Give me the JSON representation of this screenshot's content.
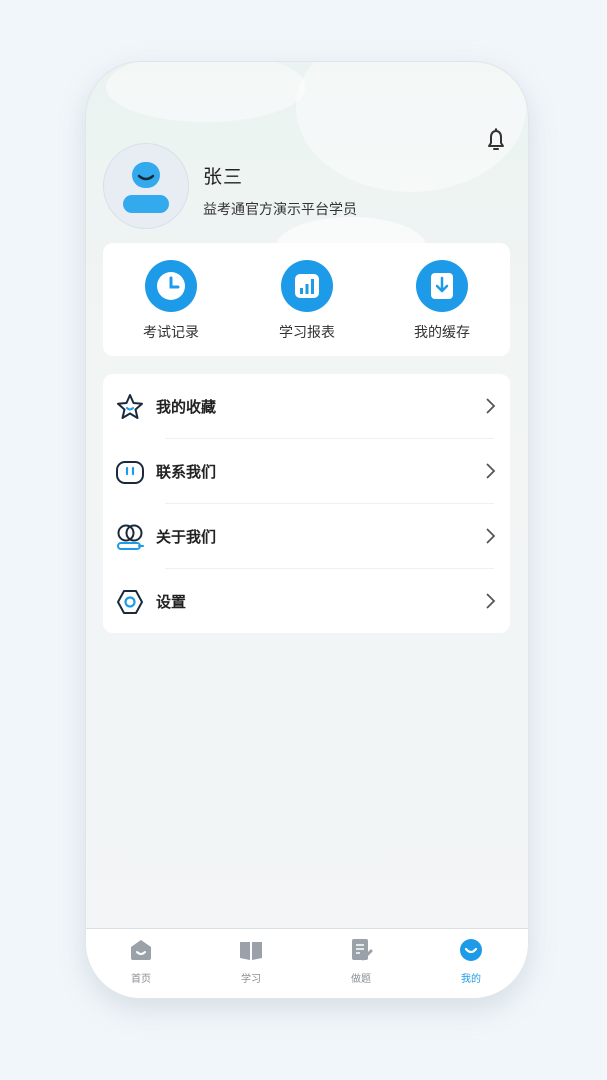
{
  "profile": {
    "name": "张三",
    "subtitle": "益考通官方演示平台学员"
  },
  "quick_actions": [
    {
      "label": "考试记录",
      "icon": "clock-icon"
    },
    {
      "label": "学习报表",
      "icon": "bar-chart-icon"
    },
    {
      "label": "我的缓存",
      "icon": "download-icon"
    }
  ],
  "menu": [
    {
      "label": "我的收藏",
      "icon": "star-icon"
    },
    {
      "label": "联系我们",
      "icon": "chat-icon"
    },
    {
      "label": "关于我们",
      "icon": "people-icon"
    },
    {
      "label": "设置",
      "icon": "settings-icon"
    }
  ],
  "tabs": [
    {
      "label": "首页",
      "icon": "home-icon",
      "active": false
    },
    {
      "label": "学习",
      "icon": "book-icon",
      "active": false
    },
    {
      "label": "做题",
      "icon": "edit-doc-icon",
      "active": false
    },
    {
      "label": "我的",
      "icon": "smile-icon",
      "active": true
    }
  ],
  "colors": {
    "accent": "#1e9be8",
    "inactive_tab": "#8a8f94"
  }
}
